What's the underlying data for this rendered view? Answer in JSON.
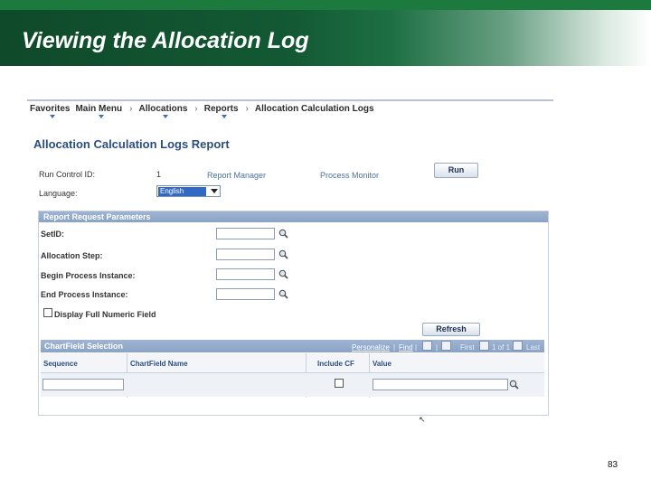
{
  "slide": {
    "title": "Viewing the Allocation Log",
    "page_number": "83"
  },
  "nav": {
    "items": [
      "Favorites",
      "Main Menu",
      "Allocations",
      "Reports",
      "Allocation Calculation Logs"
    ],
    "separator": "›"
  },
  "page": {
    "title": "Allocation Calculation Logs Report",
    "run_control_label": "Run Control ID:",
    "run_control_value": "1",
    "report_manager_link": "Report Manager",
    "process_monitor_link": "Process Monitor",
    "run_button": "Run",
    "language_label": "Language:",
    "language_value": "English"
  },
  "params": {
    "header": "Report Request Parameters",
    "setid_label": "SetID:",
    "allocation_step_label": "Allocation Step:",
    "begin_label": "Begin Process Instance:",
    "end_label": "End Process Instance:",
    "display_full_label": "Display Full Numeric Field",
    "refresh_button": "Refresh"
  },
  "chartfield": {
    "header": "ChartField Selection",
    "personalize": "Personalize",
    "find": "Find",
    "first": "First",
    "range": "1 of 1",
    "last": "Last",
    "columns": [
      "Sequence",
      "ChartField Name",
      "Include CF",
      "Value"
    ]
  },
  "icons": {
    "lookup": "magnifier-icon",
    "checkbox": "checkbox-icon"
  },
  "colors": {
    "title_bar_dark": "#0f4a2a",
    "accent_green": "#1d7a3e",
    "panel_header": "#8aa3c6",
    "link_blue": "#4a6fa0"
  }
}
